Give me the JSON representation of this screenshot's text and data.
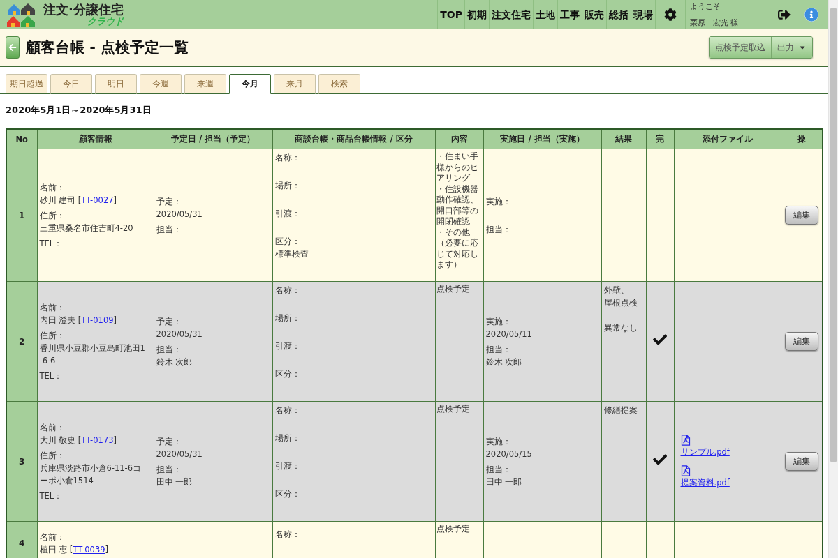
{
  "header": {
    "logo": {
      "title": "注文·分譲住宅",
      "subtitle": "クラウド"
    },
    "nav": [
      {
        "label": "TOP"
      },
      {
        "label": "初期"
      },
      {
        "label": "注文住宅"
      },
      {
        "label": "土地"
      },
      {
        "label": "工事"
      },
      {
        "label": "販売"
      },
      {
        "label": "総括"
      },
      {
        "label": "現場"
      }
    ],
    "user": {
      "greeting": "ようこそ",
      "name": "栗原　宏光 様"
    }
  },
  "page": {
    "title": "顧客台帳 - 点検予定一覧",
    "buttons": [
      {
        "label": "点検予定取込",
        "kind": "plain"
      },
      {
        "label": "出力",
        "kind": "dropdown"
      }
    ]
  },
  "tabs": [
    {
      "label": "期日超過",
      "selected": false
    },
    {
      "label": "今日",
      "selected": false
    },
    {
      "label": "明日",
      "selected": false
    },
    {
      "label": "今週",
      "selected": false
    },
    {
      "label": "来週",
      "selected": false
    },
    {
      "label": "今月",
      "selected": true
    },
    {
      "label": "来月",
      "selected": false
    },
    {
      "label": "検索",
      "selected": false
    }
  ],
  "period": "2020年5月1日～2020年5月31日",
  "table": {
    "columns": [
      "No",
      "顧客情報",
      "予定日 / 担当（予定）",
      "商談台帳・商品台帳情報 / 区分",
      "内容",
      "実施日 / 担当（実施）",
      "結果",
      "完",
      "添付ファイル",
      "操"
    ],
    "rows": [
      {
        "no": "1",
        "completed": false,
        "customer": {
          "name_label": "名前：",
          "name": "砂川 建司",
          "bracket_open": "[",
          "code": "TT-0027",
          "bracket_close": "]",
          "address_label": "住所：",
          "address": "三重県桑名市住吉町4-20",
          "tel_label": "TEL："
        },
        "plan": {
          "date_label": "予定：",
          "date": "2020/05/31",
          "staff_label": "担当："
        },
        "deal": {
          "name_label": "名称：",
          "place_label": "場所：",
          "handover_label": "引渡：",
          "category_label": "区分：",
          "category": "標準検査"
        },
        "content": [
          "・住まい手様からのヒアリング",
          "・住設機器動作確認、開口部等の開閉確認",
          "・その他（必要に応じて対応します）"
        ],
        "done": {
          "date_label": "実施：",
          "staff_label": "担当："
        },
        "action": "編集"
      },
      {
        "no": "2",
        "completed": true,
        "customer": {
          "name_label": "名前：",
          "name": "内田 澄夫",
          "bracket_open": "[",
          "code": "TT-0109",
          "bracket_close": "]",
          "address_label": "住所：",
          "address": "香川県小豆郡小豆島町池田1-6-6",
          "tel_label": "TEL："
        },
        "plan": {
          "date_label": "予定：",
          "date": "2020/05/31",
          "staff_label": "担当：",
          "staff": "鈴木 次郎"
        },
        "deal": {
          "name_label": "名称：",
          "place_label": "場所：",
          "handover_label": "引渡：",
          "category_label": "区分："
        },
        "content": [
          "点検予定"
        ],
        "done": {
          "date_label": "実施：",
          "date": "2020/05/11",
          "staff_label": "担当：",
          "staff": "鈴木 次郎"
        },
        "result": [
          [
            "外壁、",
            "屋根点検"
          ],
          [
            "異常なし"
          ]
        ],
        "action": "編集"
      },
      {
        "no": "3",
        "completed": true,
        "customer": {
          "name_label": "名前：",
          "name": "大川 敬史",
          "bracket_open": "[",
          "code": "TT-0173",
          "bracket_close": "]",
          "address_label": "住所：",
          "address": "兵庫県淡路市小倉6-11-6コーポ小倉1514",
          "tel_label": "TEL："
        },
        "plan": {
          "date_label": "予定：",
          "date": "2020/05/31",
          "staff_label": "担当：",
          "staff": "田中 一郎"
        },
        "deal": {
          "name_label": "名称：",
          "place_label": "場所：",
          "handover_label": "引渡：",
          "category_label": "区分："
        },
        "content": [
          "点検予定"
        ],
        "done": {
          "date_label": "実施：",
          "date": "2020/05/15",
          "staff_label": "担当：",
          "staff": "田中 一郎"
        },
        "result": [
          [
            "修繕提案"
          ]
        ],
        "files": [
          "サンプル.pdf",
          "提案資料.pdf"
        ],
        "action": "編集"
      },
      {
        "no": "4",
        "completed": false,
        "customer": {
          "name_label": "名前：",
          "name": "植田 恵",
          "bracket_open": "[",
          "code": "TT-0039",
          "bracket_close": "]"
        },
        "deal": {
          "name_label": "名称："
        },
        "content": [
          "点検予定"
        ]
      }
    ]
  }
}
